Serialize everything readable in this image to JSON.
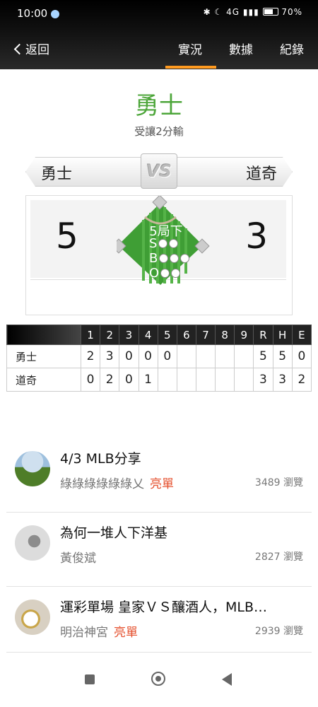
{
  "status_bar": {
    "time": "10:00",
    "indicators": "4G",
    "battery": "70%"
  },
  "nav": {
    "back_label": "返回",
    "tabs": [
      "實況",
      "數據",
      "紀錄"
    ],
    "active_tab": "實況"
  },
  "game": {
    "winner": "勇士",
    "result_text": "受讓2分輸",
    "home_team": "勇士",
    "away_team": "道奇",
    "vs_label": "VS",
    "home_score": "5",
    "away_score": "3",
    "inning": "5局下",
    "sbo": {
      "s": "S",
      "b": "B",
      "o": "O"
    }
  },
  "linescore": {
    "headers": [
      "",
      "1",
      "2",
      "3",
      "4",
      "5",
      "6",
      "7",
      "8",
      "9",
      "R",
      "H",
      "E"
    ],
    "rows": [
      {
        "team": "勇士",
        "cells": [
          "2",
          "3",
          "0",
          "0",
          "0",
          "",
          "",
          "",
          "",
          "5",
          "5",
          "0"
        ]
      },
      {
        "team": "道奇",
        "cells": [
          "0",
          "2",
          "0",
          "1",
          "",
          "",
          "",
          "",
          "",
          "3",
          "3",
          "2"
        ]
      }
    ]
  },
  "posts": [
    {
      "title": "4/3 MLB分享",
      "author": "綠綠綠綠綠綠乂",
      "badge": "亮單",
      "views": "3489 瀏覽"
    },
    {
      "title": "為何一堆人下洋基",
      "author": "黃俊斌",
      "badge": "",
      "views": "2827 瀏覽"
    },
    {
      "title": "運彩單場 皇家ＶＳ釀酒人，MLB…",
      "author": "明治神宮",
      "badge": "亮單",
      "views": "2939 瀏覽"
    }
  ],
  "colors": {
    "accent": "#ff9a1f",
    "winner": "#4da63a",
    "badge": "#e5502e"
  }
}
